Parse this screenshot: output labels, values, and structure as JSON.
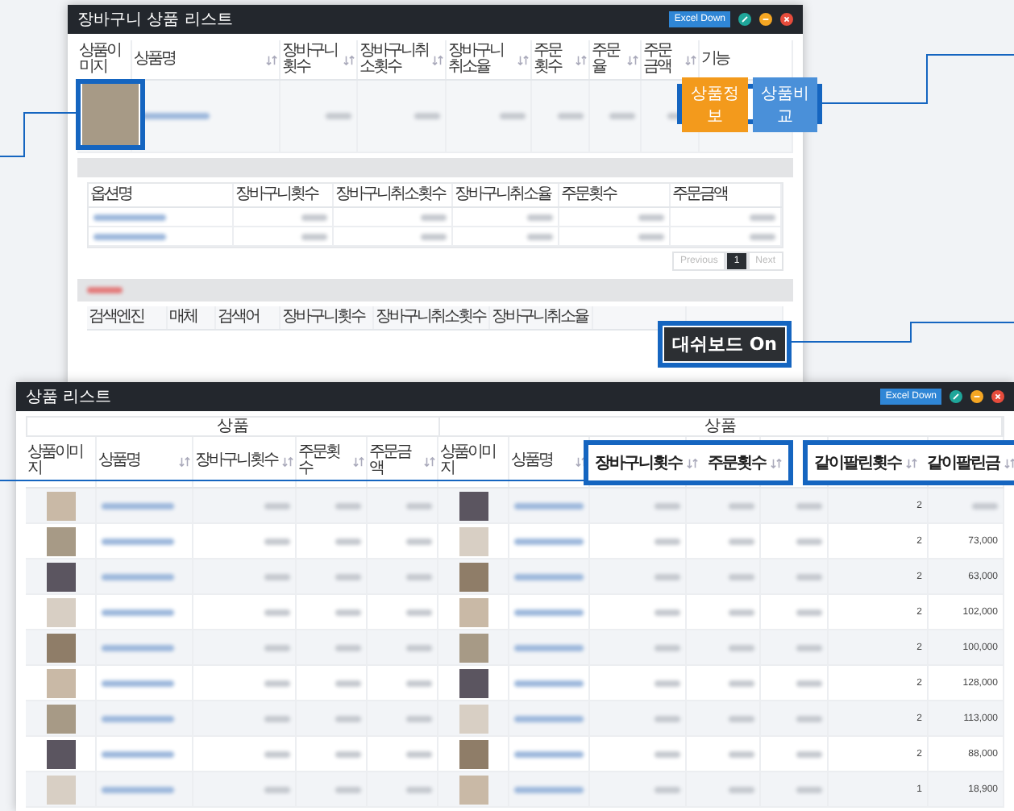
{
  "back_window": {
    "title": "장바구니 상품 리스트",
    "excel_button": "Excel Down",
    "columns": [
      {
        "label": "상품이미지",
        "sortable": false
      },
      {
        "label": "상품명",
        "sortable": true
      },
      {
        "label": "장바구니횟수",
        "sortable": true
      },
      {
        "label": "장바구니취소횟수",
        "sortable": true
      },
      {
        "label": "장바구니취소율",
        "sortable": true
      },
      {
        "label": "주문횟수",
        "sortable": true
      },
      {
        "label": "주문율",
        "sortable": true
      },
      {
        "label": "주문금액",
        "sortable": true
      },
      {
        "label": "기능",
        "sortable": false
      }
    ],
    "actions": [
      {
        "label": "상품정보",
        "kind": "primary"
      },
      {
        "label": "상품비교",
        "kind": "secondary"
      }
    ],
    "option_columns": [
      "옵션명",
      "장바구니횟수",
      "장바구니취소횟수",
      "장바구니취소율",
      "주문횟수",
      "주문금액"
    ],
    "previous": {
      "label": "Previous",
      "disabled": true
    },
    "pages": [
      {
        "label": "1",
        "selected": true
      }
    ],
    "next": {
      "label": "Next",
      "disabled": true
    },
    "channel_columns": [
      "검색엔진",
      "매체",
      "검색어",
      "장바구니횟수",
      "장바구니취소횟수",
      "장바구니취소율"
    ],
    "dashboard_badge": "대쉬보드 On"
  },
  "front_window": {
    "title": "상품 리스트",
    "excel_button": "Excel Down",
    "groups": [
      "상품",
      "상품"
    ],
    "columns": [
      {
        "label": "상품이미지",
        "sortable": false
      },
      {
        "label": "상품명",
        "sortable": true
      },
      {
        "label": "장바구니횟수",
        "sortable": true
      },
      {
        "label": "주문횟수",
        "sortable": true
      },
      {
        "label": "주문금액",
        "sortable": true
      },
      {
        "label": "상품이미지",
        "sortable": false
      },
      {
        "label": "상품명",
        "sortable": true
      }
    ],
    "rows": [
      {
        "sold_count": "2"
      },
      {
        "sold_count": "2",
        "sold_amount": "73,000"
      },
      {
        "sold_count": "2",
        "sold_amount": "63,000"
      },
      {
        "sold_count": "2",
        "sold_amount": "102,000"
      },
      {
        "sold_count": "2",
        "sold_amount": "100,000"
      },
      {
        "sold_count": "2",
        "sold_amount": "128,000"
      },
      {
        "sold_count": "2",
        "sold_amount": "113,000"
      },
      {
        "sold_count": "2",
        "sold_amount": "88,000"
      },
      {
        "sold_count": "1",
        "sold_amount": "18,900"
      }
    ],
    "callouts": [
      {
        "columns": [
          "장바구니횟수",
          "주문횟수"
        ]
      },
      {
        "columns": [
          "같이팔린횟수",
          "같이팔린금"
        ]
      }
    ]
  }
}
